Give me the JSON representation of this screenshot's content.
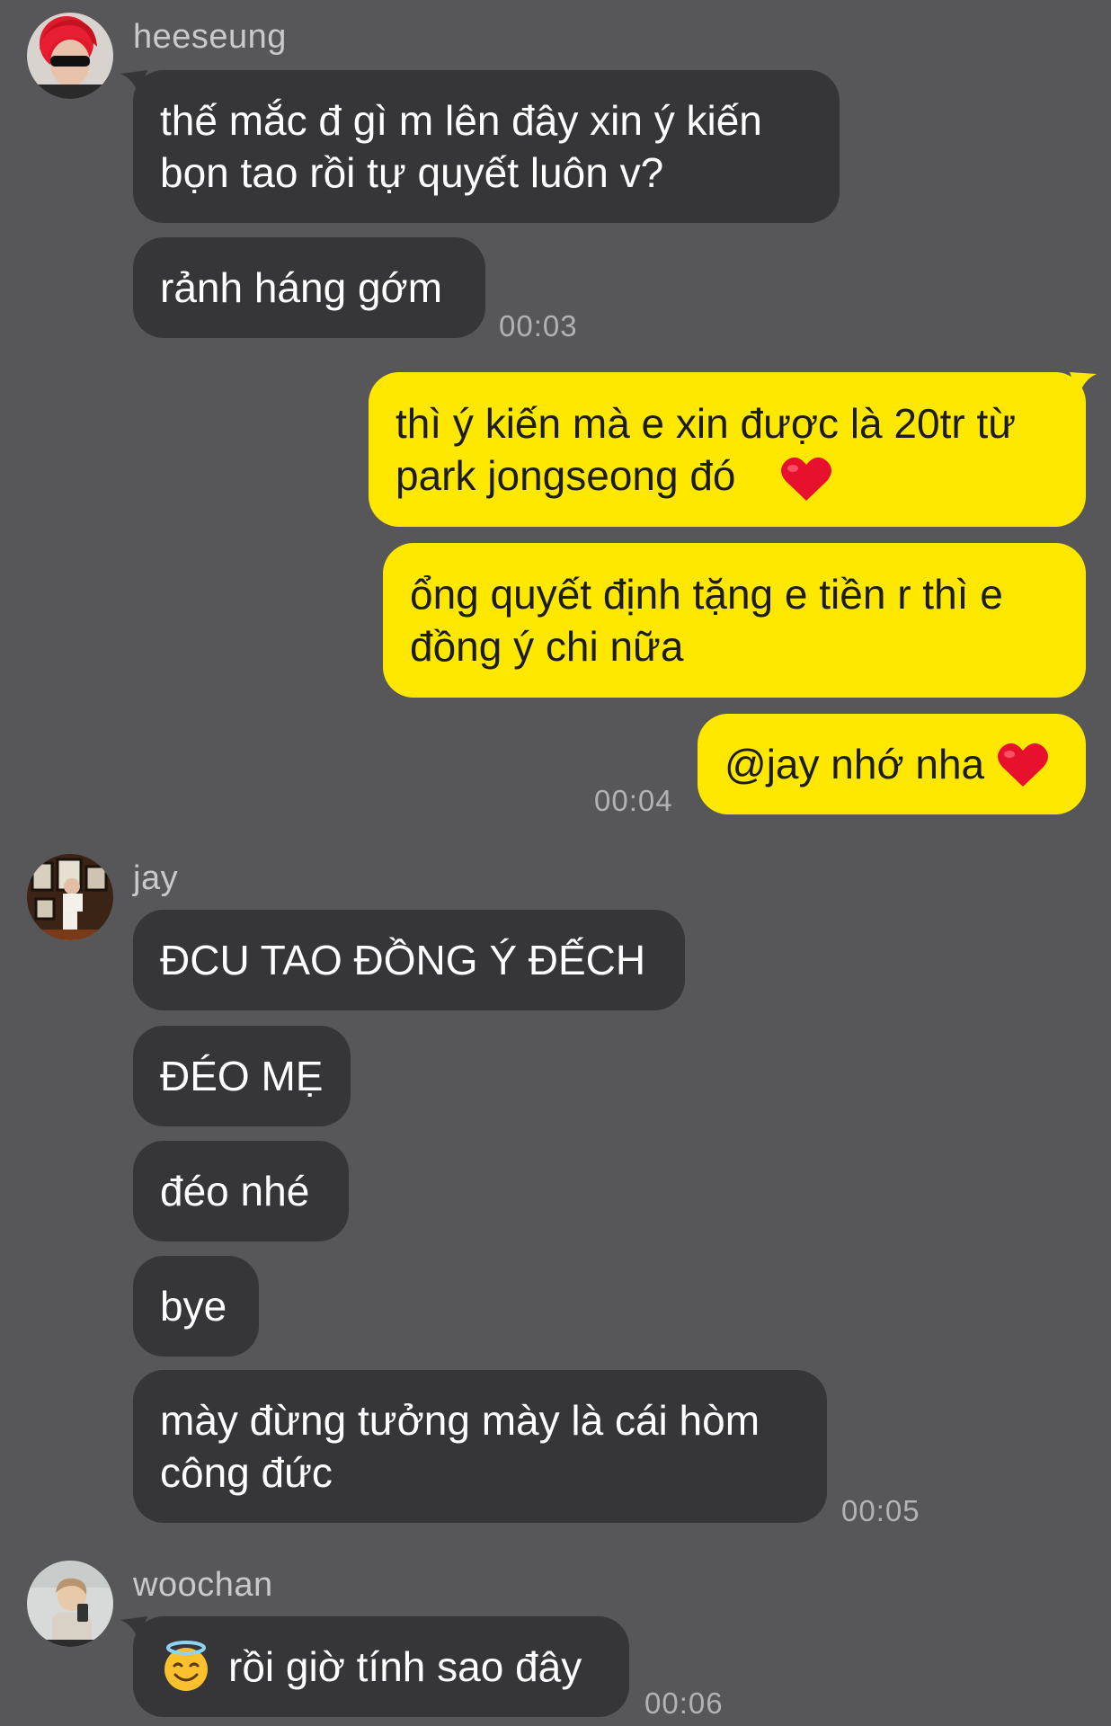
{
  "messages": {
    "group1": {
      "sender": "heeseung",
      "bubble1": "thế mắc đ gì m lên đây xin ý kiến\nbọn tao rồi tự quyết luôn v?",
      "bubble2": "rảnh háng gớm",
      "time": "00:03"
    },
    "outgoing": {
      "bubble1": "thì ý kiến mà e xin được là 20tr từ\npark jongseong đó",
      "bubble2": "ổng quyết định tặng e tiền r thì e\nđồng ý chi nữa",
      "bubble3": "@jay nhớ nha",
      "time": "00:04"
    },
    "group2": {
      "sender": "jay",
      "bubble1": "ĐCU TAO ĐỒNG Ý ĐẾCH",
      "bubble2": "ĐÉO MẸ",
      "bubble3": "đéo nhé",
      "bubble4": "bye",
      "bubble5": "mày đừng tưởng mày là cái hòm\ncông đức",
      "time": "00:05"
    },
    "group3": {
      "sender": "woochan",
      "bubble1": "rồi giờ tính sao đây",
      "time": "00:06"
    }
  },
  "icons": {
    "heart": "red-heart-icon",
    "smile": "smiling-face-with-halo-icon"
  },
  "colors": {
    "background": "#575658",
    "incoming_bubble": "#363538",
    "outgoing_bubble": "#ffe800",
    "heart": "#e8112d",
    "halo_face": "#fbc02d"
  }
}
